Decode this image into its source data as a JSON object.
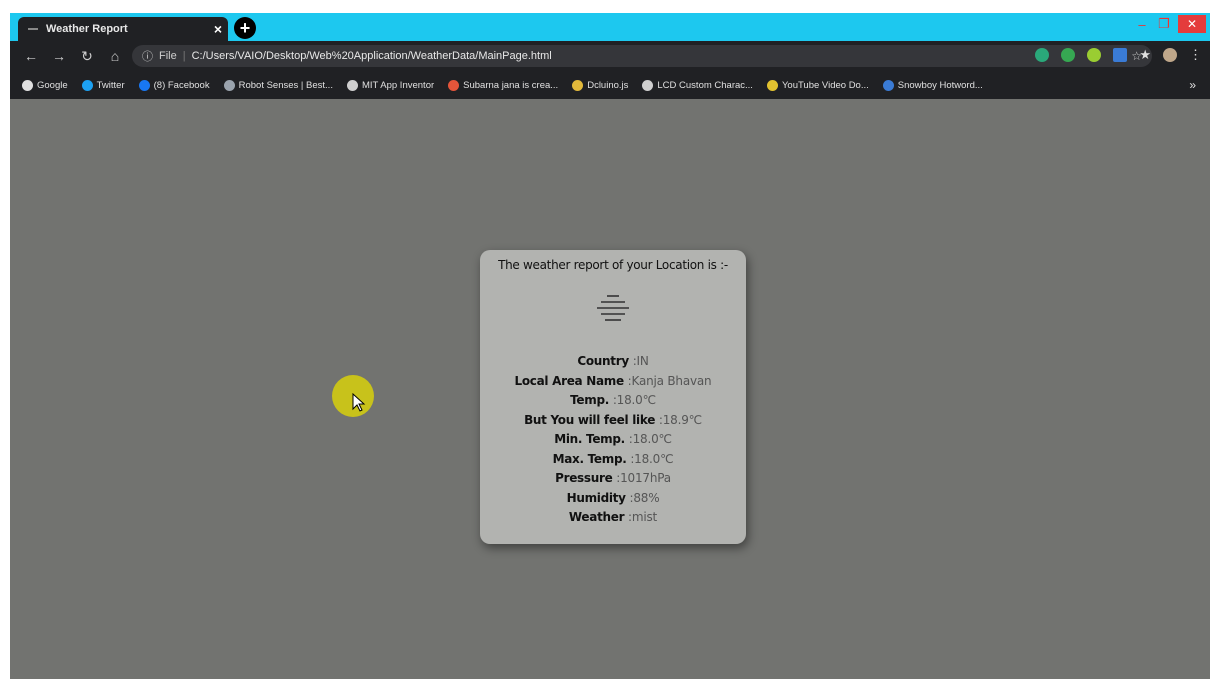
{
  "browser": {
    "tab_title": "Weather Report",
    "tab_close": "×",
    "new_tab": "+",
    "address": {
      "scheme": "File",
      "url": "C:/Users/VAIO/Desktop/Web%20Application/WeatherData/MainPage.html"
    },
    "bookmarks": [
      {
        "label": "Google",
        "icon": "google-icon",
        "color": "#e0e0e0"
      },
      {
        "label": "Twitter",
        "icon": "twitter-icon",
        "color": "#1da1f2"
      },
      {
        "label": "(8) Facebook",
        "icon": "facebook-icon",
        "color": "#1877f2"
      },
      {
        "label": "Robot Senses | Best...",
        "icon": "robot-icon",
        "color": "#9aa3ad"
      },
      {
        "label": "MIT App Inventor",
        "icon": "mit-icon",
        "color": "#cfcfcf"
      },
      {
        "label": "Subarna jana is crea...",
        "icon": "subarna-icon",
        "color": "#e5553a"
      },
      {
        "label": "Dcluino.js",
        "icon": "dcluino-icon",
        "color": "#e2b93b"
      },
      {
        "label": "LCD Custom Charac...",
        "icon": "lcd-icon",
        "color": "#cfcfcf"
      },
      {
        "label": "YouTube Video Do...",
        "icon": "youtube-download-icon",
        "color": "#e2c230"
      },
      {
        "label": "Snowboy Hotword...",
        "icon": "snowboy-icon",
        "color": "#3a7bd5"
      }
    ],
    "bookmarks_more": "»"
  },
  "card": {
    "title": "The weather report of your Location is :-",
    "icon": "mist-icon",
    "rows": [
      {
        "label": "Country",
        "value": ":IN"
      },
      {
        "label": "Local Area Name",
        "value": ":Kanja Bhavan"
      },
      {
        "label": "Temp.",
        "value": ":18.0℃"
      },
      {
        "label": "But You will feel like",
        "value": ":18.9℃"
      },
      {
        "label": "Min. Temp.",
        "value": ":18.0℃"
      },
      {
        "label": "Max. Temp.",
        "value": ":18.0℃"
      },
      {
        "label": "Pressure",
        "value": ":1017hPa"
      },
      {
        "label": "Humidity",
        "value": ":88%"
      },
      {
        "label": "Weather",
        "value": ":mist"
      }
    ]
  },
  "colors": {
    "titlebar": "#1dc8ef",
    "page_background": "#727370",
    "card_background": "#b2b3b0",
    "cursor_highlight": "#c8c21b"
  }
}
